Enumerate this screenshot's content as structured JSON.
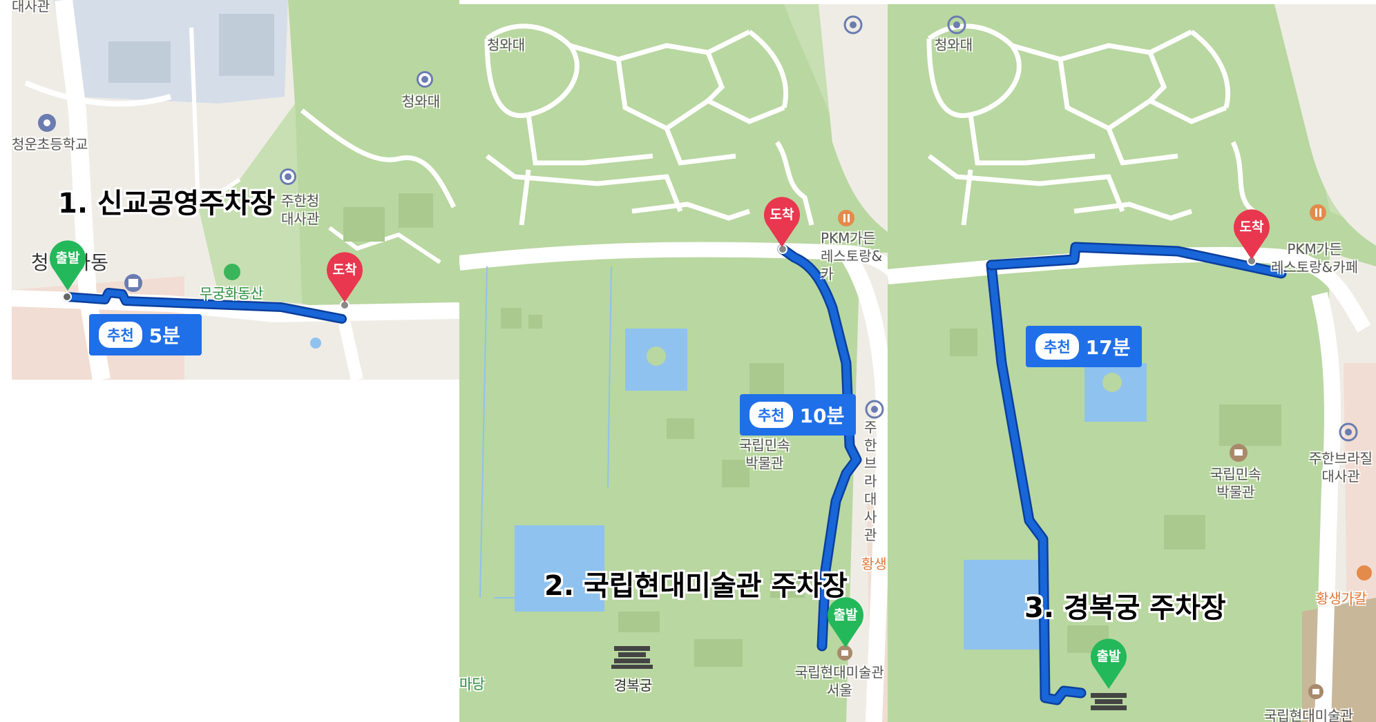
{
  "colors": {
    "park": "#b9d7a0",
    "urban": "#efece6",
    "road": "#ffffff",
    "water": "#8fc2ef",
    "route": "#1866d8",
    "route_edge": "#0b3f9c",
    "arrival_pin": "#e8374f",
    "departure_pin": "#23b85a",
    "badge": "#1f6fe8"
  },
  "panels": [
    {
      "title": "1. 신교공영주차장",
      "departure_label": "출발",
      "arrival_label": "도착",
      "badge_tag": "추천",
      "badge_time": "5분",
      "poi": {
        "top_left": "대사관",
        "school": "청운초등학교",
        "cheongwadae": "청와대",
        "embassy_partial": "주한청\n대사관",
        "place_partial": "청  효자동",
        "park_partial": "무궁화동산"
      }
    },
    {
      "title": "2. 국립현대미술관 주차장",
      "departure_label": "출발",
      "arrival_label": "도착",
      "badge_tag": "추천",
      "badge_time": "10분",
      "poi": {
        "cheongwadae": "청와대",
        "restaurant": "PKM가든\n레스토랑&카",
        "folk_museum": "국립민속\n박물관",
        "palace": "경복궁",
        "mmca": "국립현대미술관\n서울",
        "madang": "마당",
        "embassy_partial": "주한브라\n대사관",
        "hwangsaeng": "황생가"
      }
    },
    {
      "title": "3. 경복궁 주차장",
      "departure_label": "출발",
      "arrival_label": "도착",
      "badge_tag": "추천",
      "badge_time": "17분",
      "poi": {
        "cheongwadae": "청와대",
        "restaurant": "PKM가든\n레스토랑&카페",
        "folk_museum": "국립민속\n박물관",
        "embassy": "주한브라질\n대사관",
        "hwangsaeng": "황생가칼",
        "mmca_partial": "국립현대미술관"
      }
    }
  ]
}
